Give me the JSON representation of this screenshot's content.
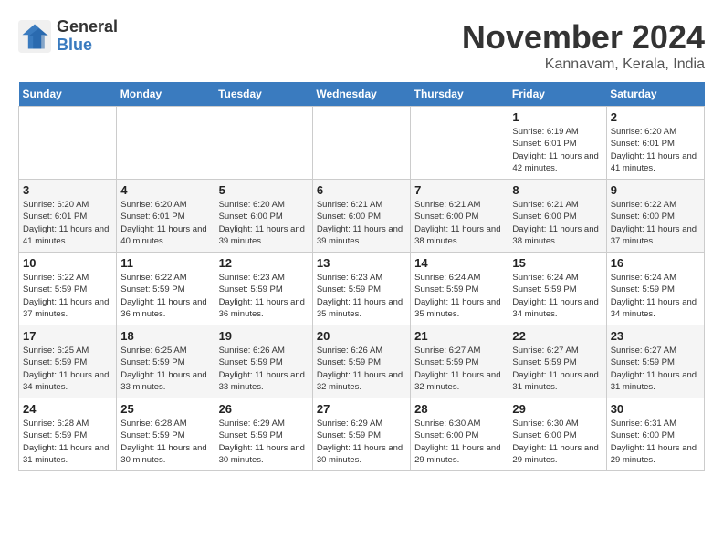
{
  "logo": {
    "line1": "General",
    "line2": "Blue"
  },
  "title": "November 2024",
  "location": "Kannavam, Kerala, India",
  "weekdays": [
    "Sunday",
    "Monday",
    "Tuesday",
    "Wednesday",
    "Thursday",
    "Friday",
    "Saturday"
  ],
  "weeks": [
    [
      {
        "day": "",
        "info": ""
      },
      {
        "day": "",
        "info": ""
      },
      {
        "day": "",
        "info": ""
      },
      {
        "day": "",
        "info": ""
      },
      {
        "day": "",
        "info": ""
      },
      {
        "day": "1",
        "info": "Sunrise: 6:19 AM\nSunset: 6:01 PM\nDaylight: 11 hours and 42 minutes."
      },
      {
        "day": "2",
        "info": "Sunrise: 6:20 AM\nSunset: 6:01 PM\nDaylight: 11 hours and 41 minutes."
      }
    ],
    [
      {
        "day": "3",
        "info": "Sunrise: 6:20 AM\nSunset: 6:01 PM\nDaylight: 11 hours and 41 minutes."
      },
      {
        "day": "4",
        "info": "Sunrise: 6:20 AM\nSunset: 6:01 PM\nDaylight: 11 hours and 40 minutes."
      },
      {
        "day": "5",
        "info": "Sunrise: 6:20 AM\nSunset: 6:00 PM\nDaylight: 11 hours and 39 minutes."
      },
      {
        "day": "6",
        "info": "Sunrise: 6:21 AM\nSunset: 6:00 PM\nDaylight: 11 hours and 39 minutes."
      },
      {
        "day": "7",
        "info": "Sunrise: 6:21 AM\nSunset: 6:00 PM\nDaylight: 11 hours and 38 minutes."
      },
      {
        "day": "8",
        "info": "Sunrise: 6:21 AM\nSunset: 6:00 PM\nDaylight: 11 hours and 38 minutes."
      },
      {
        "day": "9",
        "info": "Sunrise: 6:22 AM\nSunset: 6:00 PM\nDaylight: 11 hours and 37 minutes."
      }
    ],
    [
      {
        "day": "10",
        "info": "Sunrise: 6:22 AM\nSunset: 5:59 PM\nDaylight: 11 hours and 37 minutes."
      },
      {
        "day": "11",
        "info": "Sunrise: 6:22 AM\nSunset: 5:59 PM\nDaylight: 11 hours and 36 minutes."
      },
      {
        "day": "12",
        "info": "Sunrise: 6:23 AM\nSunset: 5:59 PM\nDaylight: 11 hours and 36 minutes."
      },
      {
        "day": "13",
        "info": "Sunrise: 6:23 AM\nSunset: 5:59 PM\nDaylight: 11 hours and 35 minutes."
      },
      {
        "day": "14",
        "info": "Sunrise: 6:24 AM\nSunset: 5:59 PM\nDaylight: 11 hours and 35 minutes."
      },
      {
        "day": "15",
        "info": "Sunrise: 6:24 AM\nSunset: 5:59 PM\nDaylight: 11 hours and 34 minutes."
      },
      {
        "day": "16",
        "info": "Sunrise: 6:24 AM\nSunset: 5:59 PM\nDaylight: 11 hours and 34 minutes."
      }
    ],
    [
      {
        "day": "17",
        "info": "Sunrise: 6:25 AM\nSunset: 5:59 PM\nDaylight: 11 hours and 34 minutes."
      },
      {
        "day": "18",
        "info": "Sunrise: 6:25 AM\nSunset: 5:59 PM\nDaylight: 11 hours and 33 minutes."
      },
      {
        "day": "19",
        "info": "Sunrise: 6:26 AM\nSunset: 5:59 PM\nDaylight: 11 hours and 33 minutes."
      },
      {
        "day": "20",
        "info": "Sunrise: 6:26 AM\nSunset: 5:59 PM\nDaylight: 11 hours and 32 minutes."
      },
      {
        "day": "21",
        "info": "Sunrise: 6:27 AM\nSunset: 5:59 PM\nDaylight: 11 hours and 32 minutes."
      },
      {
        "day": "22",
        "info": "Sunrise: 6:27 AM\nSunset: 5:59 PM\nDaylight: 11 hours and 31 minutes."
      },
      {
        "day": "23",
        "info": "Sunrise: 6:27 AM\nSunset: 5:59 PM\nDaylight: 11 hours and 31 minutes."
      }
    ],
    [
      {
        "day": "24",
        "info": "Sunrise: 6:28 AM\nSunset: 5:59 PM\nDaylight: 11 hours and 31 minutes."
      },
      {
        "day": "25",
        "info": "Sunrise: 6:28 AM\nSunset: 5:59 PM\nDaylight: 11 hours and 30 minutes."
      },
      {
        "day": "26",
        "info": "Sunrise: 6:29 AM\nSunset: 5:59 PM\nDaylight: 11 hours and 30 minutes."
      },
      {
        "day": "27",
        "info": "Sunrise: 6:29 AM\nSunset: 5:59 PM\nDaylight: 11 hours and 30 minutes."
      },
      {
        "day": "28",
        "info": "Sunrise: 6:30 AM\nSunset: 6:00 PM\nDaylight: 11 hours and 29 minutes."
      },
      {
        "day": "29",
        "info": "Sunrise: 6:30 AM\nSunset: 6:00 PM\nDaylight: 11 hours and 29 minutes."
      },
      {
        "day": "30",
        "info": "Sunrise: 6:31 AM\nSunset: 6:00 PM\nDaylight: 11 hours and 29 minutes."
      }
    ]
  ]
}
